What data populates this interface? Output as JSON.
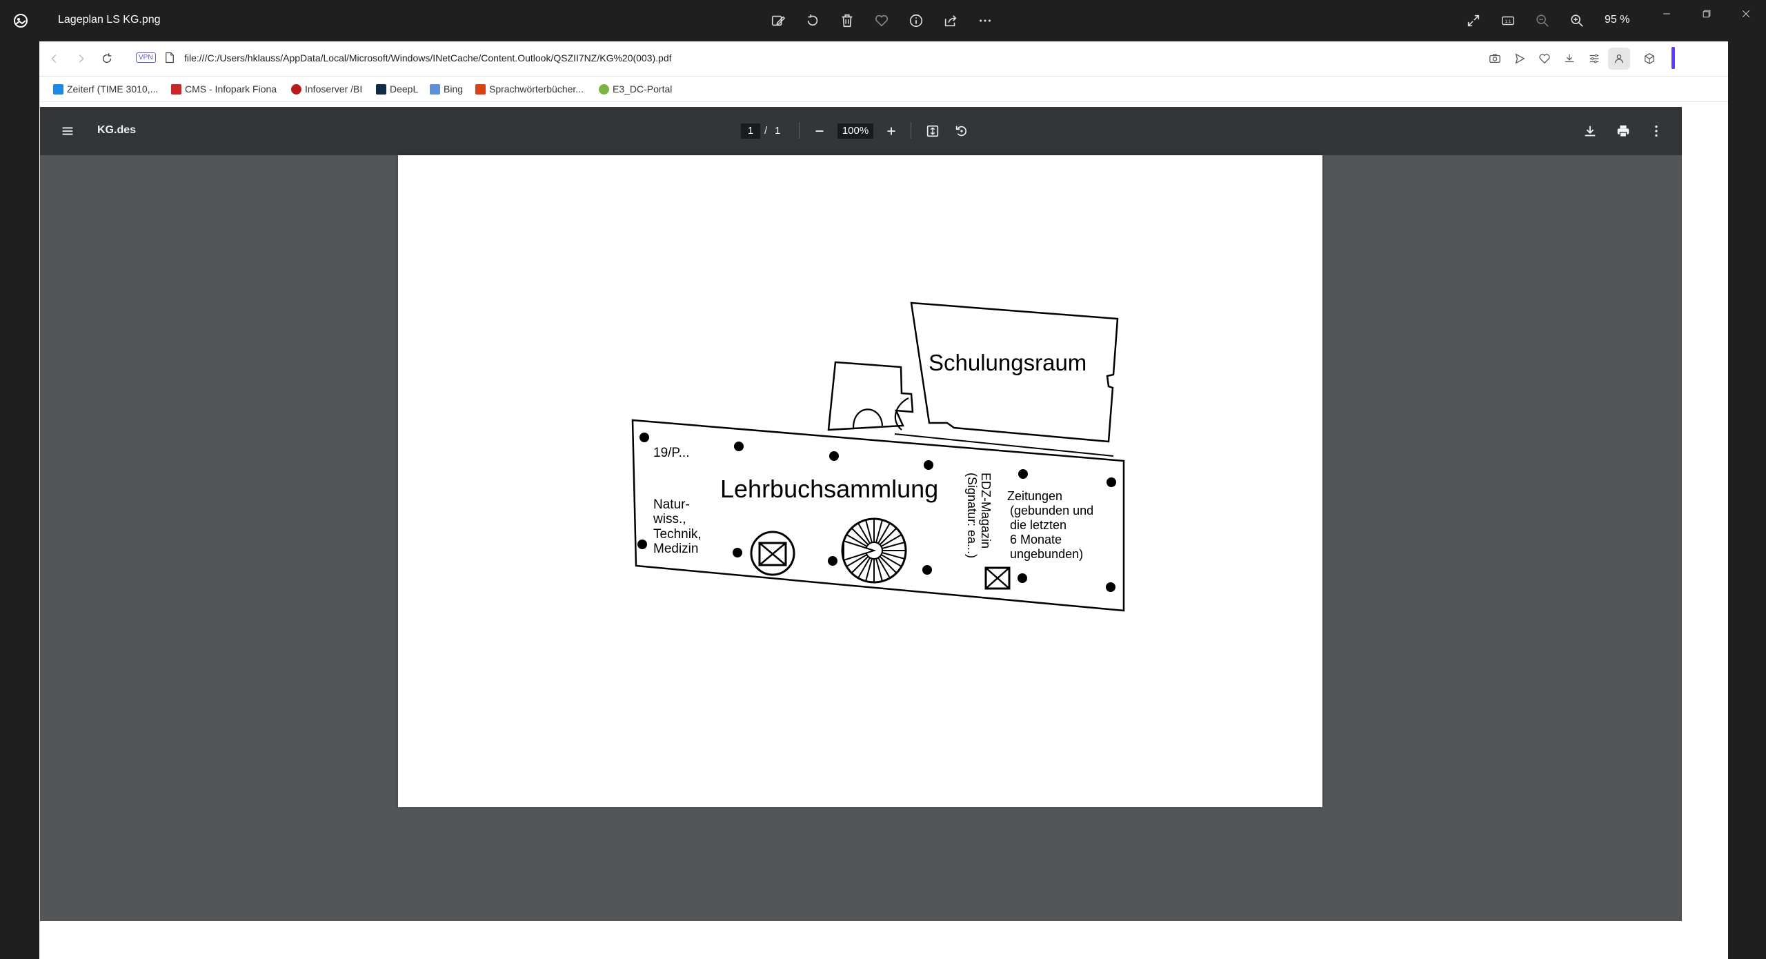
{
  "viewer": {
    "title": "Lageplan LS KG.png",
    "zoom": "95 %"
  },
  "browser": {
    "vpn_label": "VPN",
    "url": "file:///C:/Users/hklauss/AppData/Local/Microsoft/Windows/INetCache/Content.Outlook/QSZII7NZ/KG%20(003).pdf",
    "bookmarks": [
      {
        "label": "Zeiterf  (TIME 3010,...",
        "color": "#1e88e5"
      },
      {
        "label": "CMS - Infopark Fiona",
        "color": "#c62828"
      },
      {
        "label": "Infoserver /BI",
        "color": "#b71c1c"
      },
      {
        "label": "DeepL",
        "color": "#0f2b46"
      },
      {
        "label": "Bing",
        "color": "#5c8fd6"
      },
      {
        "label": "Sprachwörterbücher...",
        "color": "#d84315"
      },
      {
        "label": "E3_DC-Portal",
        "color": "#7cb342"
      }
    ]
  },
  "pdf": {
    "file_name": "KG.des",
    "page_current": "1",
    "page_separator": "/",
    "page_total": "1",
    "zoom": "100%"
  },
  "plan": {
    "room_top": "Schulungsraum",
    "main_area": "Lehrbuchsammlung",
    "shelf_code": "19/P...",
    "left_section": [
      "Natur-",
      "wiss.,",
      "Technik,",
      "Medizin"
    ],
    "edz_lines": [
      "EDZ-Magazin",
      "(Signatur: ea...)"
    ],
    "newspapers": [
      "Zeitungen",
      "(gebunden und",
      "die letzten",
      "6 Monate",
      "ungebunden)"
    ]
  }
}
